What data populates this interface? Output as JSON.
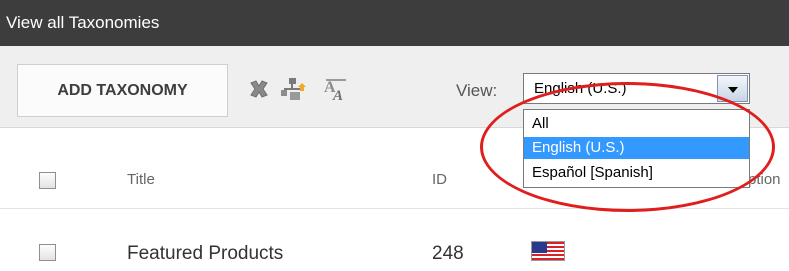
{
  "window": {
    "title": "View all Taxonomies"
  },
  "toolbar": {
    "add_button_label": "ADD TAXONOMY",
    "icons": [
      "delete-icon",
      "import-icon",
      "translate-icon"
    ],
    "view_label": "View:",
    "view_select": {
      "selected": "English (U.S.)",
      "options": [
        "All",
        "English (U.S.)",
        "Español [Spanish]"
      ],
      "highlighted_option": "English (U.S.)"
    }
  },
  "table": {
    "columns": {
      "title": "Title",
      "id": "ID",
      "description_partial": "ption"
    },
    "rows": [
      {
        "title": "Featured Products",
        "id": "248",
        "flag": "us-flag-icon"
      }
    ]
  },
  "colors": {
    "title_bar": "#3d3d3d",
    "toolbar_bg": "#efefef",
    "selection_highlight": "#3399ff",
    "annotation_circle": "#e01e1e"
  }
}
